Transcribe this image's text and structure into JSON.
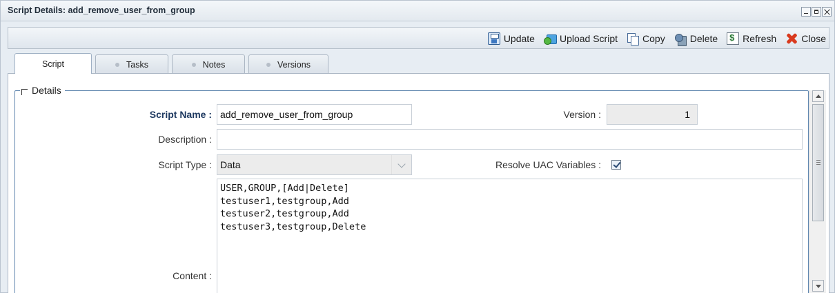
{
  "window": {
    "title": "Script Details: add_remove_user_from_group"
  },
  "toolbar": {
    "buttons": [
      {
        "label": "Update",
        "icon": "save-icon"
      },
      {
        "label": "Upload Script",
        "icon": "upload-icon"
      },
      {
        "label": "Copy",
        "icon": "copy-icon"
      },
      {
        "label": "Delete",
        "icon": "delete-icon"
      },
      {
        "label": "Refresh",
        "icon": "refresh-icon"
      },
      {
        "label": "Close",
        "icon": "close-icon"
      }
    ]
  },
  "tabs": [
    {
      "label": "Script",
      "active": true
    },
    {
      "label": "Tasks",
      "active": false
    },
    {
      "label": "Notes",
      "active": false
    },
    {
      "label": "Versions",
      "active": false
    }
  ],
  "details": {
    "legend": "Details",
    "script_name_label": "Script Name :",
    "script_name_value": "add_remove_user_from_group",
    "version_label": "Version :",
    "version_value": "1",
    "description_label": "Description :",
    "description_value": "",
    "script_type_label": "Script Type :",
    "script_type_value": "Data",
    "resolve_uac_label": "Resolve UAC Variables :",
    "resolve_uac_checked": true,
    "content_label": "Content :",
    "content_value": "USER,GROUP,[Add|Delete]\ntestuser1,testgroup,Add\ntestuser2,testgroup,Add\ntestuser3,testgroup,Delete"
  },
  "colors": {
    "label_strong": "#1e3960",
    "fieldset_border": "#5e85ae",
    "close_icon": "#d93a1e"
  }
}
